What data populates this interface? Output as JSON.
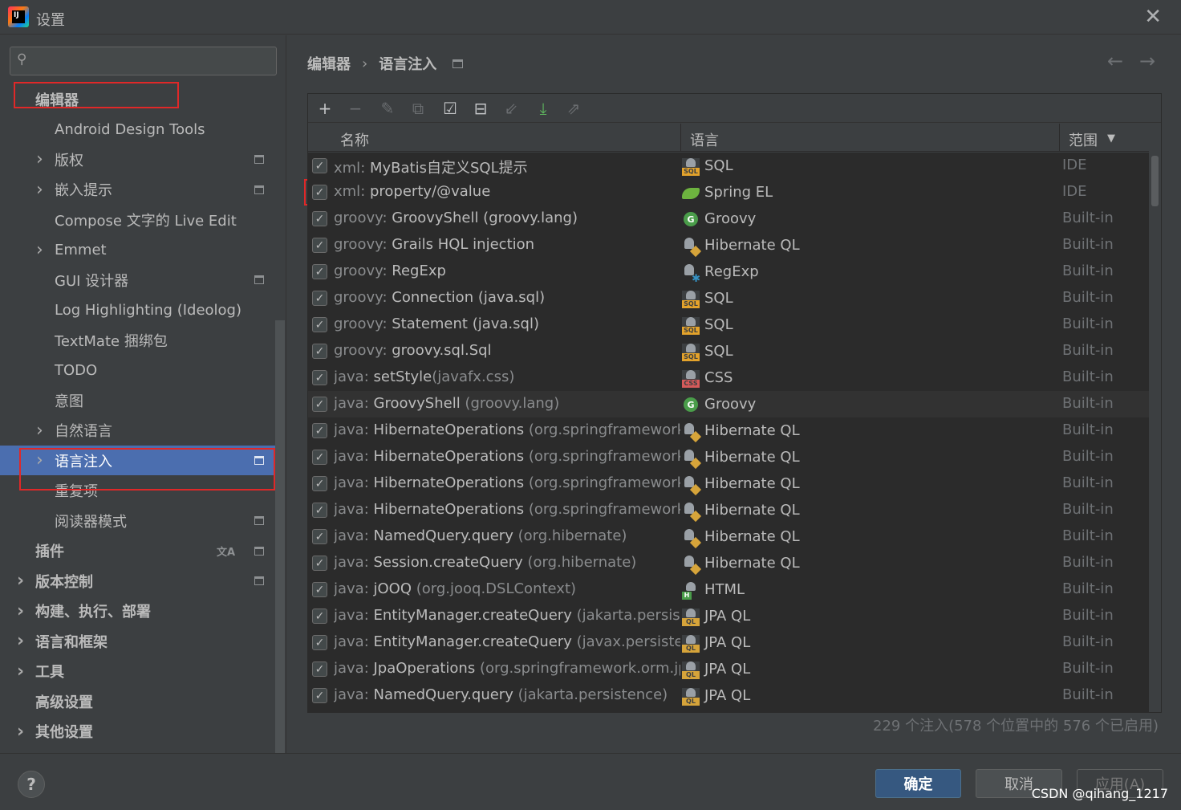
{
  "window": {
    "title": "设置",
    "close": "✕"
  },
  "search": {
    "placeholder": "",
    "value": ""
  },
  "sidebar": {
    "items": [
      {
        "label": "编辑器",
        "bold": true,
        "indent": 0,
        "chevron": false,
        "project": false
      },
      {
        "label": "Android Design Tools",
        "indent": 1,
        "chevron": false,
        "project": false
      },
      {
        "label": "版权",
        "indent": 1,
        "chevron": true,
        "project": true
      },
      {
        "label": "嵌入提示",
        "indent": 1,
        "chevron": true,
        "project": true
      },
      {
        "label": "Compose 文字的 Live Edit",
        "indent": 1,
        "chevron": false,
        "project": false
      },
      {
        "label": "Emmet",
        "indent": 1,
        "chevron": true,
        "project": false
      },
      {
        "label": "GUI 设计器",
        "indent": 1,
        "chevron": false,
        "project": true
      },
      {
        "label": "Log Highlighting (Ideolog)",
        "indent": 1,
        "chevron": false,
        "project": false
      },
      {
        "label": "TextMate 捆绑包",
        "indent": 1,
        "chevron": false,
        "project": false
      },
      {
        "label": "TODO",
        "indent": 1,
        "chevron": false,
        "project": false
      },
      {
        "label": "意图",
        "indent": 1,
        "chevron": false,
        "project": false
      },
      {
        "label": "自然语言",
        "indent": 1,
        "chevron": true,
        "project": false
      },
      {
        "label": "语言注入",
        "indent": 1,
        "chevron": true,
        "project": true,
        "selected": true
      },
      {
        "label": "重复项",
        "indent": 1,
        "chevron": false,
        "project": false
      },
      {
        "label": "阅读器模式",
        "indent": 1,
        "chevron": false,
        "project": true
      },
      {
        "label": "插件",
        "bold": true,
        "indent": 0,
        "chevron": false,
        "project": true,
        "translate": true
      },
      {
        "label": "版本控制",
        "bold": true,
        "indent": 0,
        "chevron": true,
        "project": true
      },
      {
        "label": "构建、执行、部署",
        "bold": true,
        "indent": 0,
        "chevron": true,
        "project": false
      },
      {
        "label": "语言和框架",
        "bold": true,
        "indent": 0,
        "chevron": true,
        "project": false
      },
      {
        "label": "工具",
        "bold": true,
        "indent": 0,
        "chevron": true,
        "project": false
      },
      {
        "label": "高级设置",
        "bold": true,
        "indent": 0,
        "chevron": false,
        "project": false
      },
      {
        "label": "其他设置",
        "bold": true,
        "indent": 0,
        "chevron": true,
        "project": false
      }
    ]
  },
  "breadcrumb": {
    "parent": "编辑器",
    "separator": "›",
    "current": "语言注入"
  },
  "nav": {
    "back": "←",
    "forward": "→"
  },
  "toolbar": {
    "add": "+",
    "remove": "−",
    "edit": "✎",
    "copy": "⧉",
    "enable_all": "☑",
    "disable_all": "⊟",
    "import": "⇙",
    "download": "⤓",
    "export": "⇗"
  },
  "table": {
    "headers": {
      "name": "名称",
      "language": "语言",
      "scope": "范围",
      "sort": "▼"
    },
    "rows": [
      {
        "prefix": "xml: ",
        "main": "MyBatis自定义SQL提示",
        "suffix": "",
        "lang": "SQL",
        "icon": "sql",
        "scope": "IDE"
      },
      {
        "prefix": "xml: ",
        "main": "property/@value",
        "suffix": "",
        "lang": "Spring EL",
        "icon": "spring",
        "scope": "IDE"
      },
      {
        "prefix": "groovy: ",
        "main": "GroovyShell (groovy.lang)",
        "suffix": "",
        "lang": "Groovy",
        "icon": "groovy",
        "scope": "Built-in"
      },
      {
        "prefix": "groovy: ",
        "main": "Grails HQL injection",
        "suffix": "",
        "lang": "Hibernate QL",
        "icon": "hibernate",
        "scope": "Built-in"
      },
      {
        "prefix": "groovy: ",
        "main": "RegExp",
        "suffix": "",
        "lang": "RegExp",
        "icon": "regexp",
        "scope": "Built-in"
      },
      {
        "prefix": "groovy: ",
        "main": "Connection (java.sql)",
        "suffix": "",
        "lang": "SQL",
        "icon": "sql",
        "scope": "Built-in"
      },
      {
        "prefix": "groovy: ",
        "main": "Statement (java.sql)",
        "suffix": "",
        "lang": "SQL",
        "icon": "sql",
        "scope": "Built-in"
      },
      {
        "prefix": "groovy: ",
        "main": "groovy.sql.Sql",
        "suffix": "",
        "lang": "SQL",
        "icon": "sql",
        "scope": "Built-in"
      },
      {
        "prefix": "java: ",
        "main": "setStyle",
        "suffix": "(javafx.css)",
        "lang": "CSS",
        "icon": "css",
        "scope": "Built-in"
      },
      {
        "prefix": "java: ",
        "main": "GroovyShell",
        "suffix": " (groovy.lang)",
        "lang": "Groovy",
        "icon": "groovy",
        "scope": "Built-in",
        "hover": true
      },
      {
        "prefix": "java: ",
        "main": "HibernateOperations",
        "suffix": " (org.springframework.orm",
        "lang": "Hibernate QL",
        "icon": "hibernate",
        "scope": "Built-in"
      },
      {
        "prefix": "java: ",
        "main": "HibernateOperations",
        "suffix": " (org.springframework.orm",
        "lang": "Hibernate QL",
        "icon": "hibernate",
        "scope": "Built-in"
      },
      {
        "prefix": "java: ",
        "main": "HibernateOperations",
        "suffix": " (org.springframework.orm",
        "lang": "Hibernate QL",
        "icon": "hibernate",
        "scope": "Built-in"
      },
      {
        "prefix": "java: ",
        "main": "HibernateOperations",
        "suffix": " (org.springframework.orm",
        "lang": "Hibernate QL",
        "icon": "hibernate",
        "scope": "Built-in"
      },
      {
        "prefix": "java: ",
        "main": "NamedQuery.query",
        "suffix": " (org.hibernate)",
        "lang": "Hibernate QL",
        "icon": "hibernate",
        "scope": "Built-in"
      },
      {
        "prefix": "java: ",
        "main": "Session.createQuery",
        "suffix": " (org.hibernate)",
        "lang": "Hibernate QL",
        "icon": "hibernate",
        "scope": "Built-in"
      },
      {
        "prefix": "java: ",
        "main": "jOOQ",
        "suffix": " (org.jooq.DSLContext)",
        "lang": "HTML",
        "icon": "html",
        "scope": "Built-in"
      },
      {
        "prefix": "java: ",
        "main": "EntityManager.createQuery",
        "suffix": " (jakarta.persistence)",
        "lang": "JPA QL",
        "icon": "jpa",
        "scope": "Built-in"
      },
      {
        "prefix": "java: ",
        "main": "EntityManager.createQuery",
        "suffix": " (javax.persistence)",
        "lang": "JPA QL",
        "icon": "jpa",
        "scope": "Built-in"
      },
      {
        "prefix": "java: ",
        "main": "JpaOperations",
        "suffix": " (org.springframework.orm.jpa)",
        "lang": "JPA QL",
        "icon": "jpa",
        "scope": "Built-in"
      },
      {
        "prefix": "java: ",
        "main": "NamedQuery.query",
        "suffix": " (jakarta.persistence)",
        "lang": "JPA QL",
        "icon": "jpa",
        "scope": "Built-in"
      }
    ]
  },
  "status": "229 个注入(578 个位置中的 576 个已启用)",
  "footer": {
    "help": "?",
    "ok": "确定",
    "cancel": "取消",
    "apply": "应用(A)",
    "watermark": "CSDN @qihang_1217"
  },
  "colors": {
    "selection": "#4b6eaf",
    "annotation": "#e02828",
    "ok_button": "#365880"
  }
}
